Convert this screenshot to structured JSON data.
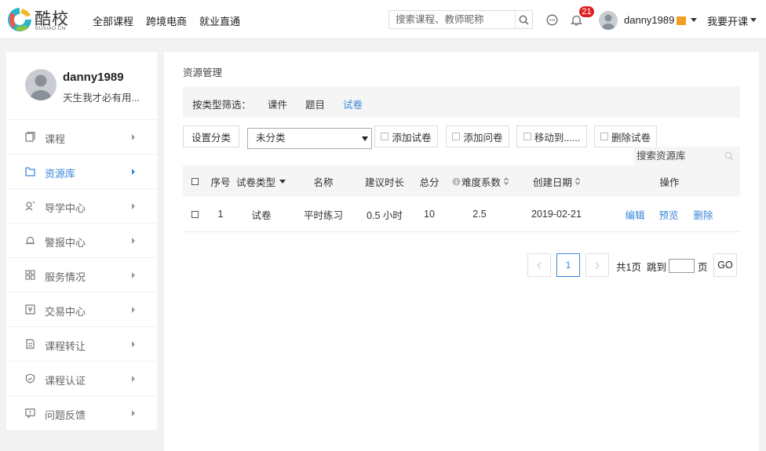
{
  "header": {
    "logo_text": "酷校",
    "logo_sub": "KUXIAO.CN",
    "nav": [
      "全部课程",
      "跨境电商",
      "就业直通"
    ],
    "search_placeholder": "搜索课程、教师昵称",
    "notification_count": "21",
    "username": "danny1989",
    "teach_label": "我要开课"
  },
  "sidebar": {
    "profile_name": "danny1989",
    "profile_signature": "天生我才必有用...",
    "items": [
      {
        "label": "课程",
        "icon": "course-icon",
        "active": false
      },
      {
        "label": "资源库",
        "icon": "folder-icon",
        "active": true
      },
      {
        "label": "导学中心",
        "icon": "guide-icon",
        "active": false
      },
      {
        "label": "警报中心",
        "icon": "alarm-icon",
        "active": false
      },
      {
        "label": "服务情况",
        "icon": "grid-icon",
        "active": false
      },
      {
        "label": "交易中心",
        "icon": "yen-icon",
        "active": false
      },
      {
        "label": "课程转让",
        "icon": "transfer-icon",
        "active": false
      },
      {
        "label": "课程认证",
        "icon": "shield-icon",
        "active": false
      },
      {
        "label": "问题反馈",
        "icon": "feedback-icon",
        "active": false
      }
    ]
  },
  "main": {
    "breadcrumb": "资源管理",
    "filter": {
      "label": "按类型筛选：",
      "options": [
        "课件",
        "题目",
        "试卷"
      ],
      "active_index": 2
    },
    "toolbar": {
      "set_category": "设置分类",
      "category_value": "未分类",
      "add_paper": "添加试卷",
      "add_questionnaire": "添加问卷",
      "move_to": "移动到......",
      "delete_paper": "删除试卷"
    },
    "library_search_placeholder": "搜索资源库",
    "table": {
      "headers": {
        "index": "序号",
        "type": "试卷类型",
        "name": "名称",
        "duration": "建议时长",
        "score": "总分",
        "difficulty": "难度系数",
        "created": "创建日期",
        "actions": "操作"
      },
      "rows": [
        {
          "index": "1",
          "type": "试卷",
          "name": "平时练习",
          "duration": "0.5 小时",
          "score": "10",
          "difficulty": "2.5",
          "created": "2019-02-21",
          "edit": "编辑",
          "preview": "预览",
          "delete": "删除"
        }
      ]
    },
    "pagination": {
      "current_page": "1",
      "total_label": "共1页",
      "jump_label": "跳到",
      "page_suffix": "页",
      "go_label": "GO"
    }
  },
  "colors": {
    "accent": "#3a87d9",
    "badge": "#e02020",
    "vip": "#f0a020"
  }
}
